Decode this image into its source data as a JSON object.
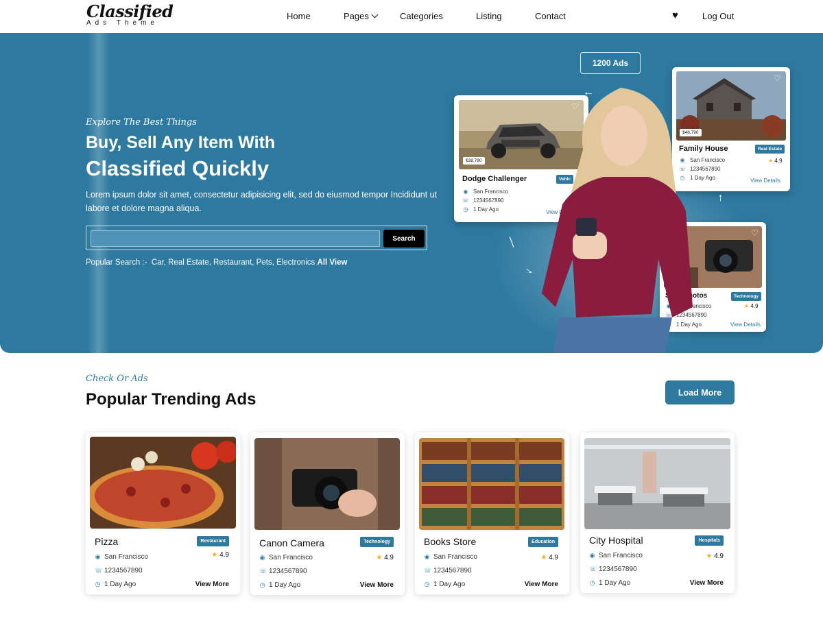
{
  "brand": {
    "name": "Classified",
    "sub": "Ads Theme"
  },
  "nav": {
    "items": [
      "Home",
      "Pages",
      "Categories",
      "Listing",
      "Contact"
    ],
    "logout": "Log Out",
    "favorites_icon": "heart-icon"
  },
  "hero": {
    "tagline": "Explore The Best Things",
    "title_line1": "Buy, Sell Any Item With",
    "title_line2": "Classified Quickly",
    "lead": "Lorem ipsum dolor sit amet, consectetur adipisicing elit, sed do eiusmod tempor Incididunt ut labore et dolore magna aliqua.",
    "search": {
      "placeholder": "",
      "button": "Search"
    },
    "popular_label": "Popular Search :-",
    "popular_items": "Car, Real Estate, Restaurant, Pets, Electronics",
    "popular_all": "All View",
    "ads_count": "1200 Ads",
    "showcase": [
      {
        "title": "Dodge Challenger",
        "tag": "Vehic",
        "price": "$38,780",
        "location": "San Francisco",
        "phone": "1234567890",
        "time": "1 Day Ago",
        "link": "View D"
      },
      {
        "title": "Family House",
        "tag": "Real Estate",
        "price": "$48,790",
        "location": "San Francisco",
        "phone": "1234567890",
        "time": "1 Day Ago",
        "rating": "4.9",
        "link": "View Details"
      },
      {
        "title": "Sony Photos",
        "tag": "Technology",
        "location": "San Francisco",
        "phone": "1234567890",
        "time": "1 Day Ago",
        "rating": "4.9",
        "link": "View Details"
      }
    ]
  },
  "section": {
    "kicker": "Check Or Ads",
    "title": "Popular Trending Ads",
    "load_more": "Load More"
  },
  "cards": [
    {
      "title": "Pizza",
      "tag": "Restaurant",
      "location": "San Francisco",
      "phone": "1234567890",
      "time": "1 Day Ago",
      "rating": "4.9",
      "more": "View More"
    },
    {
      "title": "Canon Camera",
      "tag": "Technology",
      "location": "San Francisco",
      "phone": "1234567890",
      "time": "1 Day Ago",
      "rating": "4.9",
      "more": "View More"
    },
    {
      "title": "Books Store",
      "tag": "Education",
      "location": "San Francisco",
      "phone": "1234567890",
      "time": "1 Day Ago",
      "rating": "4.9",
      "more": "View More"
    },
    {
      "title": "City Hospital",
      "tag": "Hospitals",
      "location": "San Francisco",
      "phone": "1234567890",
      "time": "1 Day Ago",
      "rating": "4.9",
      "more": "View More"
    }
  ],
  "colors": {
    "primary": "#2e79a0",
    "accent_star": "#f3b21b",
    "dark": "#000000"
  }
}
